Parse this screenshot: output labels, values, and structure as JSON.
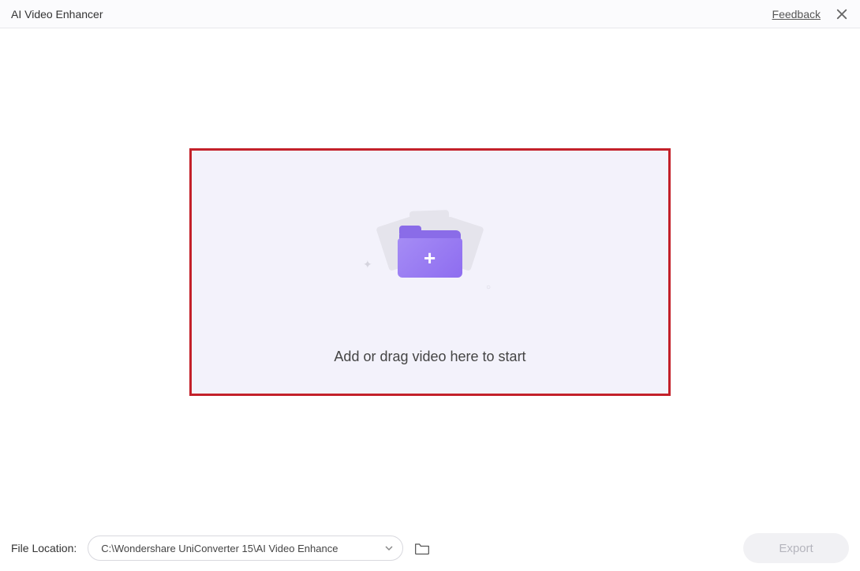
{
  "header": {
    "title": "AI Video Enhancer",
    "feedback_label": "Feedback"
  },
  "dropzone": {
    "prompt_text": "Add or drag video here to start"
  },
  "footer": {
    "file_location_label": "File Location:",
    "file_path": "C:\\Wondershare UniConverter 15\\AI Video Enhance",
    "export_label": "Export"
  },
  "colors": {
    "highlight_border": "#c3212a",
    "accent_folder": "#9674f1",
    "dropzone_bg": "#f3f2fb"
  }
}
